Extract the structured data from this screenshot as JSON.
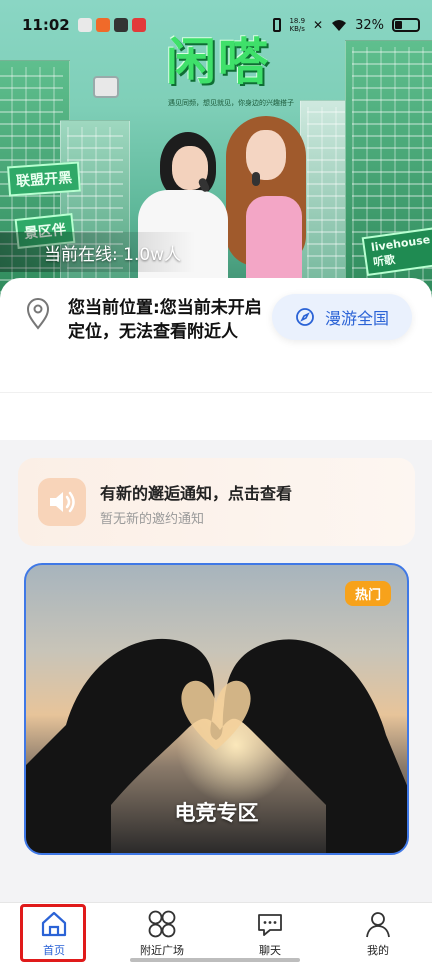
{
  "status_bar": {
    "time": "11:02",
    "net_speed_value": "18.9",
    "net_speed_unit": "KB/s",
    "battery": "32%"
  },
  "banner": {
    "app_logo": "闲嗒",
    "slogan": "遇见同频，想见就见，你身边的兴趣搭子",
    "sign_left_top": "联盟开黑",
    "sign_left_bottom": "景区伴",
    "sign_right": "livehouse听歌",
    "online_count": "当前在线: 1.0w人"
  },
  "location": {
    "text": "您当前位置:您当前未开启定位，无法查看附近人",
    "roam_button": "漫游全国"
  },
  "notice": {
    "title": "有新的邂逅通知，点击查看",
    "subtitle": "暂无新的邀约通知"
  },
  "feature_card": {
    "badge": "热门",
    "title": "电竞专区"
  },
  "bottom_nav": {
    "items": [
      {
        "label": "首页",
        "icon": "home-icon",
        "active": true
      },
      {
        "label": "附近广场",
        "icon": "grid-circles-icon",
        "active": false
      },
      {
        "label": "聊天",
        "icon": "chat-bubble-icon",
        "active": false
      },
      {
        "label": "我的",
        "icon": "person-icon",
        "active": false
      }
    ]
  },
  "colors": {
    "accent_blue": "#2b63d6",
    "badge_orange": "#f7a21b",
    "highlight_red": "#e01a1a"
  }
}
